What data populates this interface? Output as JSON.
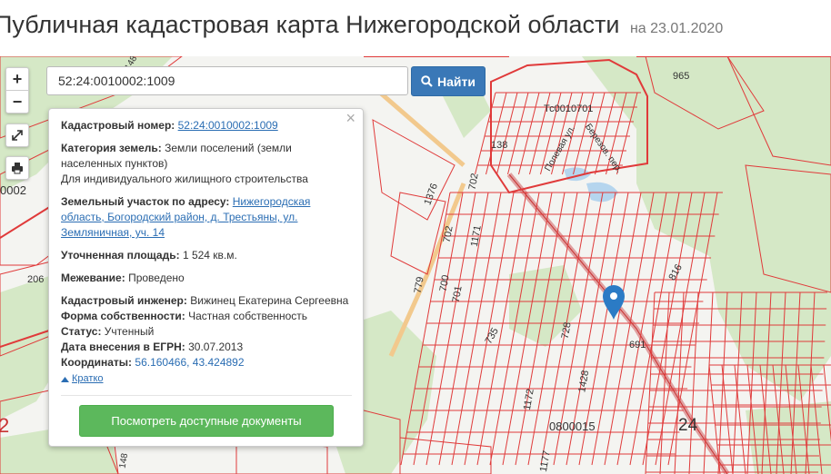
{
  "header": {
    "title": "Публичная кадастровая карта Нижегородской области",
    "date": "на 23.01.2020"
  },
  "controls": {
    "zoom_in": "+",
    "zoom_out": "−"
  },
  "search": {
    "value": "52:24:0010002:1009",
    "button": "Найти"
  },
  "popup": {
    "close": "×",
    "cadastral_number_label": "Кадастровый номер:",
    "cadastral_number": "52:24:0010002:1009",
    "land_category_label": "Категория земель:",
    "land_category": "Земли поселений (земли населенных пунктов)",
    "permitted_use": "Для индивидуального жилищного строительства",
    "address_label": "Земельный участок по адресу:",
    "address": "Нижегородская область, Богородский район, д. Трестьяны, ул. Земляничная, уч. 14",
    "area_label": "Уточненная площадь:",
    "area": "1 524 кв.м.",
    "survey_label": "Межевание:",
    "survey": "Проведено",
    "engineer_label": "Кадастровый инженер:",
    "engineer": "Вижинец Екатерина Сергеевна",
    "ownership_label": "Форма собственности:",
    "ownership": "Частная собственность",
    "status_label": "Статус:",
    "status": "Учтенный",
    "egrn_date_label": "Дата внесения в ЕГРН:",
    "egrn_date": "30.07.2013",
    "coords_label": "Координаты:",
    "coords": "56.160466, 43.424892",
    "brief_link": "Кратко",
    "docs_button": "Посмотреть доступные документы"
  },
  "map_labels": {
    "l1": "Тс0010701",
    "l2": "965",
    "l3": "138",
    "l4": "Полевая ул.",
    "l5": "Березов. пер.",
    "l6": "1376",
    "l7": "702",
    "l8": "1171",
    "l9": "702",
    "l10": "779",
    "l11": "700",
    "l12": "701",
    "l13": "816",
    "l14": "728",
    "l15": "735",
    "l16": "691",
    "l17": "1428",
    "l18": "1172",
    "l19": "0800015",
    "l20": "24",
    "l21": "1177",
    "l22": "0002",
    "l23": "206",
    "l24": "2",
    "l25": "148",
    "l26": "148"
  },
  "colors": {
    "parcel": "#e03a3a",
    "green": "#d6e9c8",
    "water": "#b5d5ee",
    "search_button": "#3a78b7",
    "docs_button": "#5cb85c",
    "marker": "#2b7bc5"
  }
}
